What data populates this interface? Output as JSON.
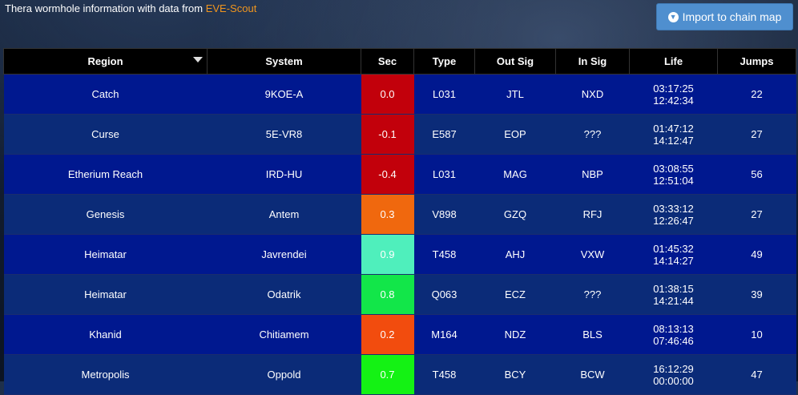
{
  "header": {
    "intro": "Thera wormhole information with data from ",
    "link": "EVE-Scout",
    "import_button": "Import to chain map"
  },
  "columns": [
    "Region",
    "System",
    "Sec",
    "Type",
    "Out Sig",
    "In Sig",
    "Life",
    "Jumps"
  ],
  "rows": [
    {
      "region": "Catch",
      "system": "9KOE-A",
      "sec": "0.0",
      "sec_color": "#c2000b",
      "type": "L031",
      "out_sig": "JTL",
      "in_sig": "NXD",
      "life1": "03:17:25",
      "life2": "12:42:34",
      "jumps": "22"
    },
    {
      "region": "Curse",
      "system": "5E-VR8",
      "sec": "-0.1",
      "sec_color": "#c2000b",
      "type": "E587",
      "out_sig": "EOP",
      "in_sig": "???",
      "life1": "01:47:12",
      "life2": "14:12:47",
      "jumps": "27"
    },
    {
      "region": "Etherium Reach",
      "system": "IRD-HU",
      "sec": "-0.4",
      "sec_color": "#c2000b",
      "type": "L031",
      "out_sig": "MAG",
      "in_sig": "NBP",
      "life1": "03:08:55",
      "life2": "12:51:04",
      "jumps": "56"
    },
    {
      "region": "Genesis",
      "system": "Antem",
      "sec": "0.3",
      "sec_color": "#f0680e",
      "type": "V898",
      "out_sig": "GZQ",
      "in_sig": "RFJ",
      "life1": "03:33:12",
      "life2": "12:26:47",
      "jumps": "27"
    },
    {
      "region": "Heimatar",
      "system": "Javrendei",
      "sec": "0.9",
      "sec_color": "#4fefbc",
      "type": "T458",
      "out_sig": "AHJ",
      "in_sig": "VXW",
      "life1": "01:45:32",
      "life2": "14:14:27",
      "jumps": "49"
    },
    {
      "region": "Heimatar",
      "system": "Odatrik",
      "sec": "0.8",
      "sec_color": "#12e649",
      "type": "Q063",
      "out_sig": "ECZ",
      "in_sig": "???",
      "life1": "01:38:15",
      "life2": "14:21:44",
      "jumps": "39"
    },
    {
      "region": "Khanid",
      "system": "Chitiamem",
      "sec": "0.2",
      "sec_color": "#f24c0e",
      "type": "M164",
      "out_sig": "NDZ",
      "in_sig": "BLS",
      "life1": "08:13:13",
      "life2": "07:46:46",
      "jumps": "10"
    },
    {
      "region": "Metropolis",
      "system": "Oppold",
      "sec": "0.7",
      "sec_color": "#14f214",
      "type": "T458",
      "out_sig": "BCY",
      "in_sig": "BCW",
      "life1": "16:12:29",
      "life2": "00:00:00",
      "jumps": "47"
    }
  ]
}
